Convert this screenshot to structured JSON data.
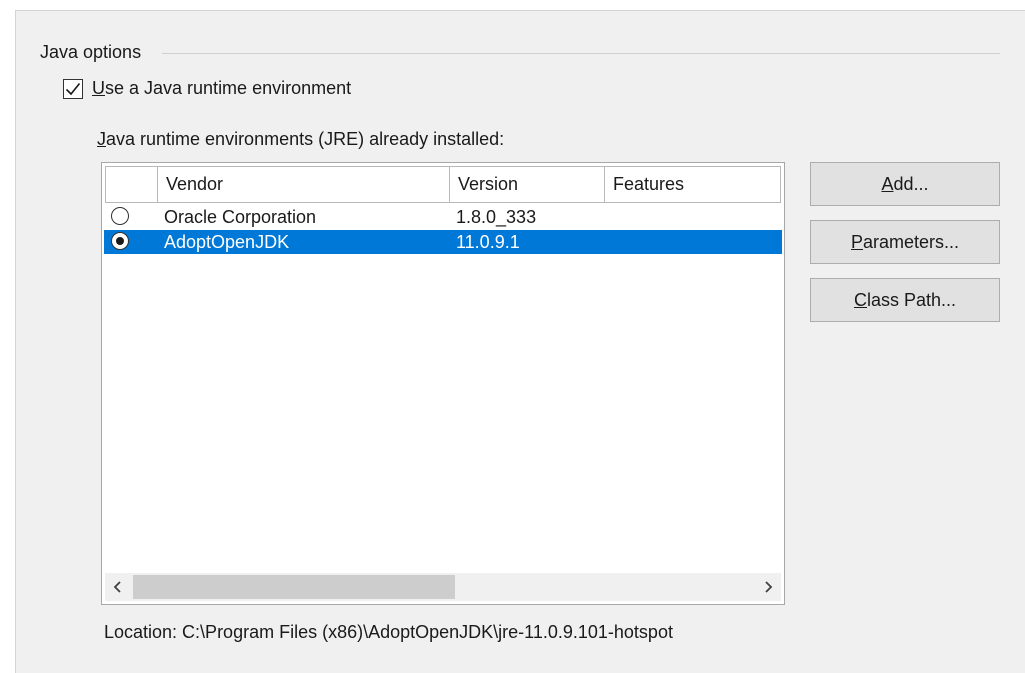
{
  "java_options": {
    "section_title": "Java options",
    "use_java": {
      "checked": true,
      "label_mnemonic": "U",
      "label_rest": "se a Java runtime environment"
    },
    "jre_list_label": {
      "mnemonic": "J",
      "rest": "ava runtime environments (JRE) already installed:"
    },
    "table": {
      "columns": [
        "",
        "Vendor",
        "Version",
        "Features"
      ],
      "rows": [
        {
          "selected": false,
          "vendor": "Oracle Corporation",
          "version": "1.8.0_333",
          "features": ""
        },
        {
          "selected": true,
          "vendor": "AdoptOpenJDK",
          "version": "11.0.9.1",
          "features": ""
        }
      ],
      "horizontal_scroll_fraction_visible": 0.52,
      "selection_color": "#0078d7"
    },
    "buttons": {
      "add": {
        "mnemonic": "A",
        "rest": "dd..."
      },
      "parameters": {
        "mnemonic": "P",
        "rest": "arameters..."
      },
      "class_path": {
        "mnemonic": "C",
        "rest": "lass Path..."
      }
    },
    "location": "Location: C:\\Program Files (x86)\\AdoptOpenJDK\\jre-11.0.9.101-hotspot"
  }
}
